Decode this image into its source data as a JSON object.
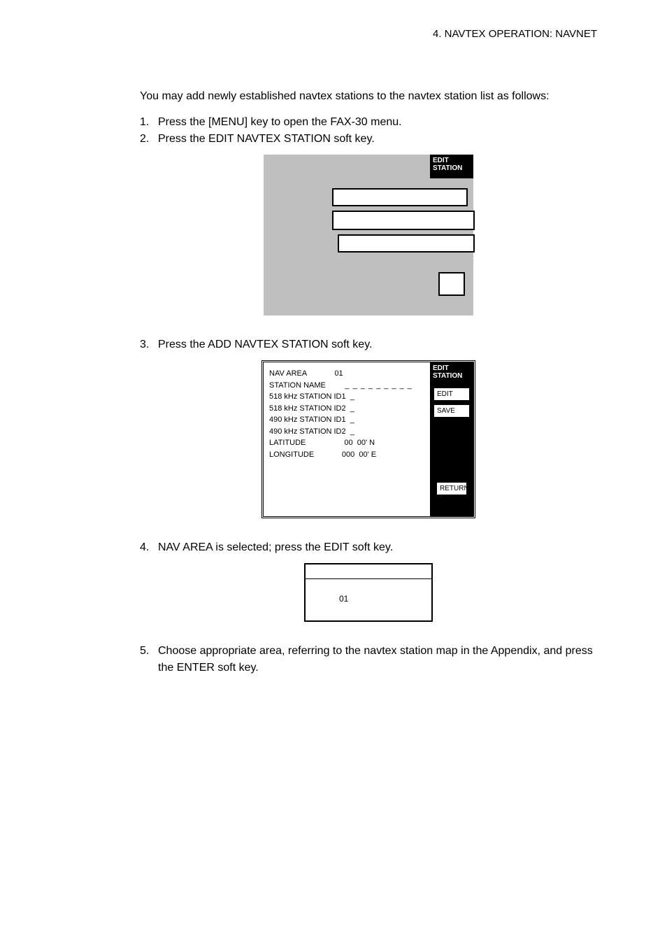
{
  "header": {
    "chapter": "4. NAVTEX OPERATION: NAVNET"
  },
  "intro": "You may add newly established navtex stations to the navtex station list as follows:",
  "steps": {
    "s1": {
      "num": "1.",
      "text": "Press the [MENU] key to open the FAX-30 menu."
    },
    "s2": {
      "num": "2.",
      "text": "Press the EDIT NAVTEX STATION soft key."
    },
    "s3": {
      "num": "3.",
      "text": "Press the ADD NAVTEX STATION soft key."
    },
    "s4": {
      "num": "4.",
      "text": "NAV AREA is selected; press the EDIT soft key."
    },
    "s5": {
      "num": "5.",
      "text": "Choose appropriate area, referring to the navtex station map in the Appendix, and press the ENTER soft key."
    }
  },
  "screen1": {
    "tab_l1": "EDIT",
    "tab_l2": "STATION"
  },
  "screen2": {
    "tab_l1": "EDIT",
    "tab_l2": "STATION",
    "btn_edit": "EDIT",
    "btn_save": "SAVE",
    "btn_return": "RETURN",
    "rows": {
      "nav_area_label": "NAV AREA",
      "nav_area_val": "01",
      "station_name_label": "STATION NAME",
      "station_name_val": "_ _ _ _ _ _ _ _ _",
      "r518_id1_label": "518 kHz STATION ID1",
      "r518_id1_val": "_",
      "r518_id2_label": "518 kHz STATION ID2",
      "r518_id2_val": "_",
      "r490_id1_label": "490 kHz STATION ID1",
      "r490_id1_val": "_",
      "r490_id2_label": "490 kHz STATION ID2",
      "r490_id2_val": "_",
      "lat_label": "LATITUDE",
      "lat_val": "00  00' N",
      "lon_label": "LONGITUDE",
      "lon_val": "000  00' E"
    }
  },
  "screen3": {
    "value": "01"
  }
}
